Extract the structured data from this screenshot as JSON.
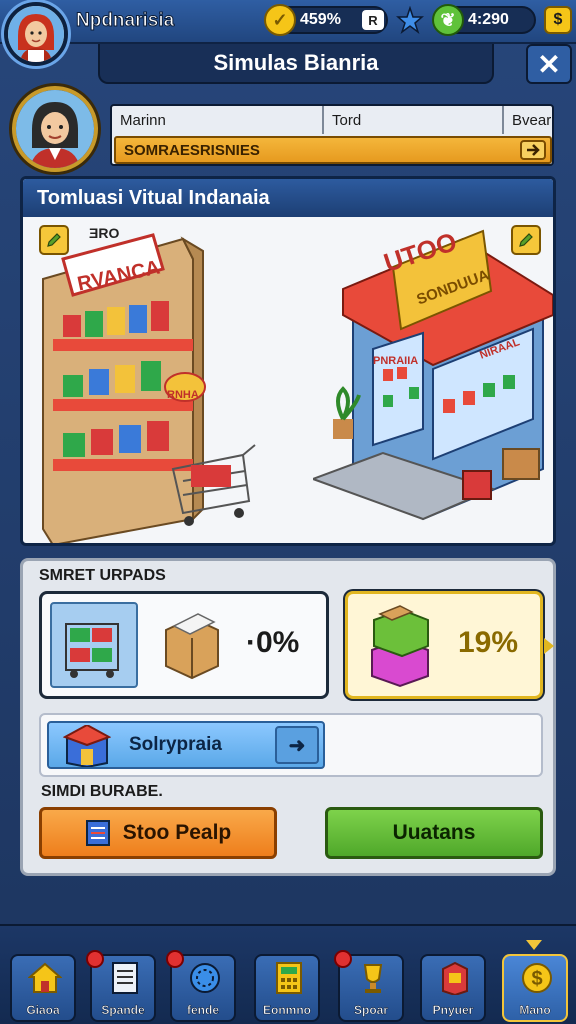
{
  "header": {
    "player_name": "Npdnarisia",
    "stat1_value": "459%",
    "stat1_button": "R",
    "stat2_value": "4:290",
    "menu_symbol": "$"
  },
  "title_bar": {
    "title": "Simulas Bianria",
    "close_symbol": "✕"
  },
  "profile": {
    "col1": "Marinn",
    "col2": "Tord",
    "col3": "Bvear",
    "status_text": "SOMRAESRISNIES"
  },
  "scene": {
    "header": "Tomluasi Vitual Indanaia",
    "shelf_sign": "RVANCA",
    "shelf_tag": "ƎRO",
    "shelf_badge": "RNHA",
    "store_sign": "UTOO",
    "store_banner": "SONDUUA",
    "store_window": "PNRAIIA",
    "store_window2": "NIRAAL"
  },
  "upgrades": {
    "section_title": "SMRET URPADS",
    "card1_value": "·0%",
    "card2_value": "19%",
    "market_label": "Solrypraia",
    "market_arrow": "➜",
    "subsection_title": "SIMDI BURABE.",
    "button_orange": "Stoo Pealp",
    "button_green": "Uuatans"
  },
  "nav": [
    {
      "label": "Giaoa",
      "icon": "home-icon",
      "badge": false
    },
    {
      "label": "Spande",
      "icon": "document-icon",
      "badge": true
    },
    {
      "label": "fende",
      "icon": "globe-icon",
      "badge": true
    },
    {
      "label": "Eonmno",
      "icon": "calculator-icon",
      "badge": false
    },
    {
      "label": "Spoar",
      "icon": "trophy-icon",
      "badge": true
    },
    {
      "label": "Pnyuer",
      "icon": "vending-icon",
      "badge": false
    },
    {
      "label": "Mano",
      "icon": "dollar-icon",
      "badge": false
    }
  ],
  "colors": {
    "primary_blue": "#2d5b9f",
    "accent_orange": "#ee7e1c",
    "accent_green": "#4fa82a",
    "accent_gold": "#f2c53a"
  }
}
